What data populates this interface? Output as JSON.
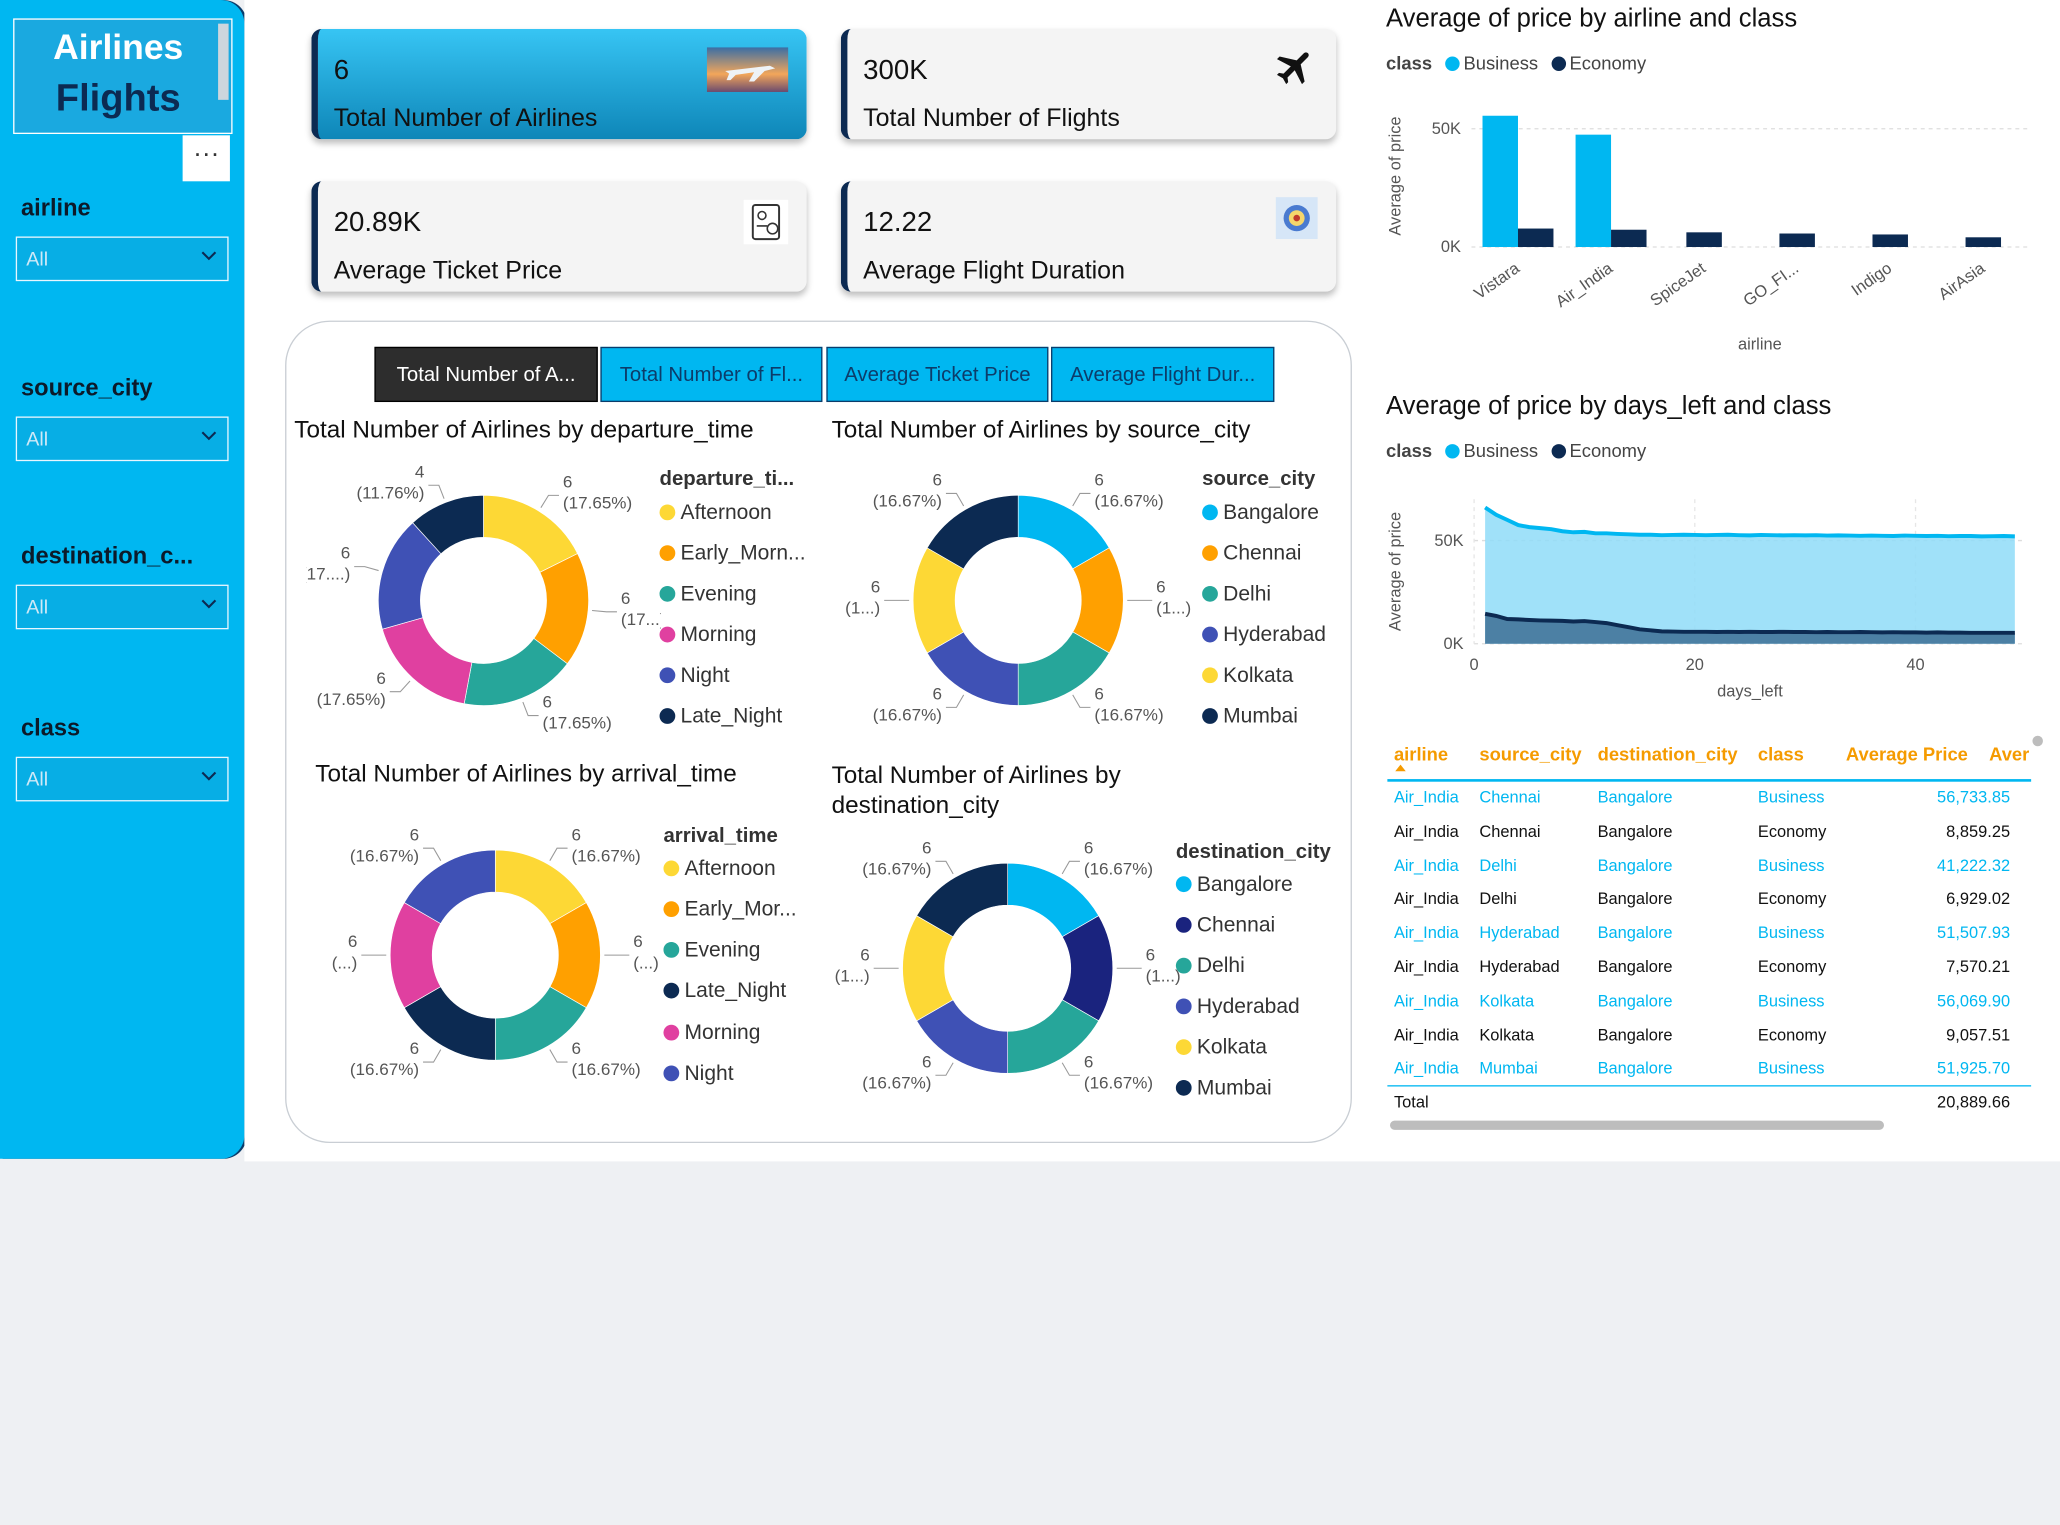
{
  "sidebar": {
    "title_line1": "Airlines",
    "title_line2": "Flights",
    "more_label": "···",
    "filters": [
      {
        "label": "airline",
        "value": "All"
      },
      {
        "label": "source_city",
        "value": "All"
      },
      {
        "label": "destination_c...",
        "value": "All"
      },
      {
        "label": "class",
        "value": "All"
      }
    ]
  },
  "kpis": [
    {
      "value": "6",
      "label": "Total Number of Airlines"
    },
    {
      "value": "300K",
      "label": "Total Number of Flights"
    },
    {
      "value": "20.89K",
      "label": "Average Ticket Price"
    },
    {
      "value": "12.22",
      "label": "Average Flight Duration"
    }
  ],
  "tabs": [
    "Total Number of A...",
    "Total Number of Fl...",
    "Average Ticket Price",
    "Average Flight Dur..."
  ],
  "colors": {
    "business": "#00b7f1",
    "economy": "#0c2a52",
    "accent": "#00b7f1"
  },
  "donuts": [
    {
      "title": "Total Number of Airlines by departure_time",
      "legend_title": "departure_ti...",
      "legend": [
        "Afternoon",
        "Early_Morn...",
        "Evening",
        "Morning",
        "Night",
        "Late_Night"
      ],
      "legend_colors": [
        "#fdd835",
        "#ffa000",
        "#26a69a",
        "#e040a0",
        "#3f51b5",
        "#0c2a52"
      ],
      "slices": [
        {
          "name": "Afternoon",
          "value": 6,
          "color": "#fdd835"
        },
        {
          "name": "Early_Morning",
          "value": 6,
          "color": "#ffa000"
        },
        {
          "name": "Evening",
          "value": 6,
          "color": "#26a69a"
        },
        {
          "name": "Morning",
          "value": 6,
          "color": "#e040a0"
        },
        {
          "name": "Night",
          "value": 6,
          "color": "#3f51b5"
        },
        {
          "name": "Late_Night",
          "value": 4,
          "color": "#0c2a52"
        }
      ],
      "labels": [
        "6\n(17.65%)",
        "6\n(17...)",
        "6\n(17.65%)",
        "6\n(17.65%)",
        "6\n(17....)",
        "4\n(11.76%)"
      ]
    },
    {
      "title": "Total Number of Airlines by source_city",
      "legend_title": "source_city",
      "legend": [
        "Bangalore",
        "Chennai",
        "Delhi",
        "Hyderabad",
        "Kolkata",
        "Mumbai"
      ],
      "legend_colors": [
        "#00b7f1",
        "#ffa000",
        "#26a69a",
        "#3f51b5",
        "#fdd835",
        "#0c2a52"
      ],
      "slices": [
        {
          "name": "Bangalore",
          "value": 6,
          "color": "#00b7f1"
        },
        {
          "name": "Chennai",
          "value": 6,
          "color": "#ffa000"
        },
        {
          "name": "Delhi",
          "value": 6,
          "color": "#26a69a"
        },
        {
          "name": "Hyderabad",
          "value": 6,
          "color": "#3f51b5"
        },
        {
          "name": "Kolkata",
          "value": 6,
          "color": "#fdd835"
        },
        {
          "name": "Mumbai",
          "value": 6,
          "color": "#0c2a52"
        }
      ],
      "labels": [
        "6\n(16.67%)",
        "6\n(1...)",
        "6\n(16.67%)",
        "6\n(16.67%)",
        "6\n(1...)",
        "6\n(16.67%)"
      ]
    },
    {
      "title": "Total Number of Airlines by arrival_time",
      "legend_title": "arrival_time",
      "legend": [
        "Afternoon",
        "Early_Mor...",
        "Evening",
        "Late_Night",
        "Morning",
        "Night"
      ],
      "legend_colors": [
        "#fdd835",
        "#ffa000",
        "#26a69a",
        "#0c2a52",
        "#e040a0",
        "#3f51b5"
      ],
      "slices": [
        {
          "name": "Afternoon",
          "value": 6,
          "color": "#fdd835"
        },
        {
          "name": "Early_Morning",
          "value": 6,
          "color": "#ffa000"
        },
        {
          "name": "Evening",
          "value": 6,
          "color": "#26a69a"
        },
        {
          "name": "Late_Night",
          "value": 6,
          "color": "#0c2a52"
        },
        {
          "name": "Morning",
          "value": 6,
          "color": "#e040a0"
        },
        {
          "name": "Night",
          "value": 6,
          "color": "#3f51b5"
        }
      ],
      "labels": [
        "6\n(16.67%)",
        "6\n(...)",
        "6\n(16.67%)",
        "6\n(16.67%)",
        "6\n(...)",
        "6\n(16.67%)"
      ]
    },
    {
      "title": "Total Number of Airlines by destination_city",
      "legend_title": "destination_city",
      "legend": [
        "Bangalore",
        "Chennai",
        "Delhi",
        "Hyderabad",
        "Kolkata",
        "Mumbai"
      ],
      "legend_colors": [
        "#00b7f1",
        "#1a237e",
        "#26a69a",
        "#3f51b5",
        "#fdd835",
        "#0c2a52"
      ],
      "slices": [
        {
          "name": "Bangalore",
          "value": 6,
          "color": "#00b7f1"
        },
        {
          "name": "Chennai",
          "value": 6,
          "color": "#1a237e"
        },
        {
          "name": "Delhi",
          "value": 6,
          "color": "#26a69a"
        },
        {
          "name": "Hyderabad",
          "value": 6,
          "color": "#3f51b5"
        },
        {
          "name": "Kolkata",
          "value": 6,
          "color": "#fdd835"
        },
        {
          "name": "Mumbai",
          "value": 6,
          "color": "#0c2a52"
        }
      ],
      "labels": [
        "6\n(16.67%)",
        "6\n(1...)",
        "6\n(16.67%)",
        "6\n(16.67%)",
        "6\n(1...)",
        "6\n(16.67%)"
      ]
    }
  ],
  "chart_data": [
    {
      "type": "bar",
      "title": "Average of price by airline and class",
      "xlabel": "airline",
      "ylabel": "Average of price",
      "legend_title": "class",
      "categories": [
        "Vistara",
        "Air_India",
        "SpiceJet",
        "GO_FI...",
        "Indigo",
        "AirAsia"
      ],
      "series": [
        {
          "name": "Business",
          "values": [
            55500,
            47500,
            0,
            0,
            0,
            0
          ]
        },
        {
          "name": "Economy",
          "values": [
            7800,
            7300,
            6200,
            5700,
            5300,
            4100
          ]
        }
      ],
      "ylim": [
        0,
        60000
      ],
      "yticks": [
        "0K",
        "50K"
      ]
    },
    {
      "type": "area",
      "title": "Average of price by days_left and class",
      "xlabel": "days_left",
      "ylabel": "Average of price",
      "legend_title": "class",
      "x": [
        1,
        2,
        3,
        4,
        5,
        6,
        7,
        8,
        9,
        10,
        11,
        12,
        13,
        14,
        15,
        16,
        17,
        18,
        19,
        20,
        21,
        22,
        23,
        24,
        25,
        26,
        27,
        28,
        29,
        30,
        31,
        32,
        33,
        34,
        35,
        36,
        37,
        38,
        39,
        40,
        41,
        42,
        43,
        44,
        45,
        46,
        47,
        48,
        49
      ],
      "series": [
        {
          "name": "Business",
          "values": [
            66000,
            62500,
            60000,
            57500,
            56500,
            56000,
            55500,
            54500,
            54000,
            54200,
            53500,
            53500,
            53200,
            53000,
            52800,
            52800,
            52600,
            52700,
            52800,
            52700,
            52600,
            52700,
            52800,
            52600,
            52500,
            52700,
            52600,
            52500,
            52600,
            52500,
            52600,
            52400,
            52500,
            52400,
            52300,
            52400,
            52300,
            52200,
            52400,
            52300,
            52200,
            52300,
            52100,
            52200,
            52200,
            52000,
            52100,
            52200,
            52000
          ]
        },
        {
          "name": "Economy",
          "values": [
            14500,
            13500,
            12000,
            11800,
            11500,
            11300,
            11200,
            11100,
            10800,
            11000,
            10500,
            10000,
            9000,
            8000,
            7000,
            6500,
            6000,
            5900,
            5800,
            5800,
            5800,
            5700,
            5800,
            5700,
            5800,
            5700,
            5700,
            5800,
            5700,
            5700,
            5600,
            5700,
            5600,
            5600,
            5700,
            5600,
            5500,
            5600,
            5500,
            5500,
            5400,
            5500,
            5400,
            5400,
            5300,
            5300,
            5300,
            5300,
            5300
          ]
        }
      ],
      "xlim": [
        0,
        50
      ],
      "ylim": [
        0,
        70000
      ],
      "xticks": [
        0,
        20,
        40
      ],
      "yticks": [
        "0K",
        "50K"
      ]
    },
    {
      "type": "table",
      "columns": [
        "airline",
        "source_city",
        "destination_city",
        "class",
        "Average Price",
        "Aver"
      ],
      "rows": [
        [
          "Air_India",
          "Chennai",
          "Bangalore",
          "Business",
          "56,733.85"
        ],
        [
          "Air_India",
          "Chennai",
          "Bangalore",
          "Economy",
          "8,859.25"
        ],
        [
          "Air_India",
          "Delhi",
          "Bangalore",
          "Business",
          "41,222.32"
        ],
        [
          "Air_India",
          "Delhi",
          "Bangalore",
          "Economy",
          "6,929.02"
        ],
        [
          "Air_India",
          "Hyderabad",
          "Bangalore",
          "Business",
          "51,507.93"
        ],
        [
          "Air_India",
          "Hyderabad",
          "Bangalore",
          "Economy",
          "7,570.21"
        ],
        [
          "Air_India",
          "Kolkata",
          "Bangalore",
          "Business",
          "56,069.90"
        ],
        [
          "Air_India",
          "Kolkata",
          "Bangalore",
          "Economy",
          "9,057.51"
        ],
        [
          "Air_India",
          "Mumbai",
          "Bangalore",
          "Business",
          "51,925.70"
        ]
      ],
      "total_label": "Total",
      "total_value": "20,889.66"
    }
  ]
}
